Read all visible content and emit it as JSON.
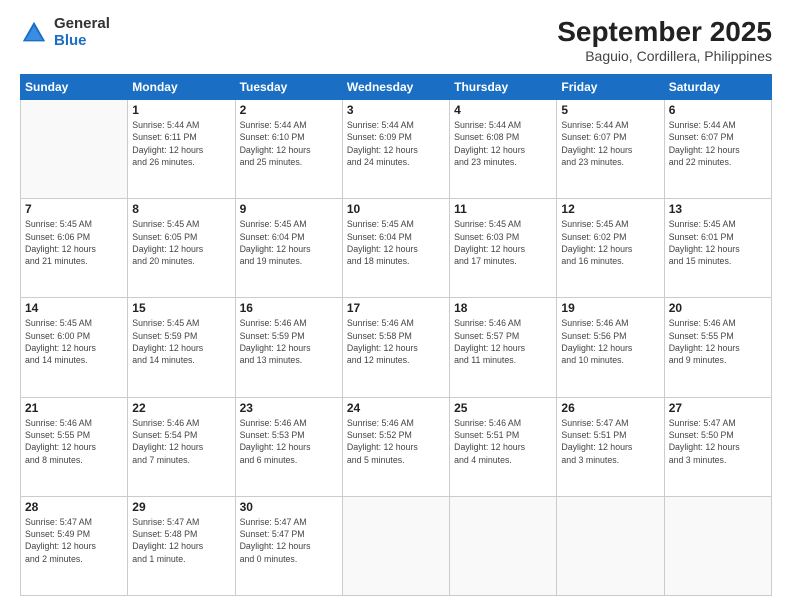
{
  "logo": {
    "general": "General",
    "blue": "Blue"
  },
  "title": "September 2025",
  "subtitle": "Baguio, Cordillera, Philippines",
  "weekdays": [
    "Sunday",
    "Monday",
    "Tuesday",
    "Wednesday",
    "Thursday",
    "Friday",
    "Saturday"
  ],
  "weeks": [
    [
      {
        "day": "",
        "info": ""
      },
      {
        "day": "1",
        "info": "Sunrise: 5:44 AM\nSunset: 6:11 PM\nDaylight: 12 hours\nand 26 minutes."
      },
      {
        "day": "2",
        "info": "Sunrise: 5:44 AM\nSunset: 6:10 PM\nDaylight: 12 hours\nand 25 minutes."
      },
      {
        "day": "3",
        "info": "Sunrise: 5:44 AM\nSunset: 6:09 PM\nDaylight: 12 hours\nand 24 minutes."
      },
      {
        "day": "4",
        "info": "Sunrise: 5:44 AM\nSunset: 6:08 PM\nDaylight: 12 hours\nand 23 minutes."
      },
      {
        "day": "5",
        "info": "Sunrise: 5:44 AM\nSunset: 6:07 PM\nDaylight: 12 hours\nand 23 minutes."
      },
      {
        "day": "6",
        "info": "Sunrise: 5:44 AM\nSunset: 6:07 PM\nDaylight: 12 hours\nand 22 minutes."
      }
    ],
    [
      {
        "day": "7",
        "info": "Sunrise: 5:45 AM\nSunset: 6:06 PM\nDaylight: 12 hours\nand 21 minutes."
      },
      {
        "day": "8",
        "info": "Sunrise: 5:45 AM\nSunset: 6:05 PM\nDaylight: 12 hours\nand 20 minutes."
      },
      {
        "day": "9",
        "info": "Sunrise: 5:45 AM\nSunset: 6:04 PM\nDaylight: 12 hours\nand 19 minutes."
      },
      {
        "day": "10",
        "info": "Sunrise: 5:45 AM\nSunset: 6:04 PM\nDaylight: 12 hours\nand 18 minutes."
      },
      {
        "day": "11",
        "info": "Sunrise: 5:45 AM\nSunset: 6:03 PM\nDaylight: 12 hours\nand 17 minutes."
      },
      {
        "day": "12",
        "info": "Sunrise: 5:45 AM\nSunset: 6:02 PM\nDaylight: 12 hours\nand 16 minutes."
      },
      {
        "day": "13",
        "info": "Sunrise: 5:45 AM\nSunset: 6:01 PM\nDaylight: 12 hours\nand 15 minutes."
      }
    ],
    [
      {
        "day": "14",
        "info": "Sunrise: 5:45 AM\nSunset: 6:00 PM\nDaylight: 12 hours\nand 14 minutes."
      },
      {
        "day": "15",
        "info": "Sunrise: 5:45 AM\nSunset: 5:59 PM\nDaylight: 12 hours\nand 14 minutes."
      },
      {
        "day": "16",
        "info": "Sunrise: 5:46 AM\nSunset: 5:59 PM\nDaylight: 12 hours\nand 13 minutes."
      },
      {
        "day": "17",
        "info": "Sunrise: 5:46 AM\nSunset: 5:58 PM\nDaylight: 12 hours\nand 12 minutes."
      },
      {
        "day": "18",
        "info": "Sunrise: 5:46 AM\nSunset: 5:57 PM\nDaylight: 12 hours\nand 11 minutes."
      },
      {
        "day": "19",
        "info": "Sunrise: 5:46 AM\nSunset: 5:56 PM\nDaylight: 12 hours\nand 10 minutes."
      },
      {
        "day": "20",
        "info": "Sunrise: 5:46 AM\nSunset: 5:55 PM\nDaylight: 12 hours\nand 9 minutes."
      }
    ],
    [
      {
        "day": "21",
        "info": "Sunrise: 5:46 AM\nSunset: 5:55 PM\nDaylight: 12 hours\nand 8 minutes."
      },
      {
        "day": "22",
        "info": "Sunrise: 5:46 AM\nSunset: 5:54 PM\nDaylight: 12 hours\nand 7 minutes."
      },
      {
        "day": "23",
        "info": "Sunrise: 5:46 AM\nSunset: 5:53 PM\nDaylight: 12 hours\nand 6 minutes."
      },
      {
        "day": "24",
        "info": "Sunrise: 5:46 AM\nSunset: 5:52 PM\nDaylight: 12 hours\nand 5 minutes."
      },
      {
        "day": "25",
        "info": "Sunrise: 5:46 AM\nSunset: 5:51 PM\nDaylight: 12 hours\nand 4 minutes."
      },
      {
        "day": "26",
        "info": "Sunrise: 5:47 AM\nSunset: 5:51 PM\nDaylight: 12 hours\nand 3 minutes."
      },
      {
        "day": "27",
        "info": "Sunrise: 5:47 AM\nSunset: 5:50 PM\nDaylight: 12 hours\nand 3 minutes."
      }
    ],
    [
      {
        "day": "28",
        "info": "Sunrise: 5:47 AM\nSunset: 5:49 PM\nDaylight: 12 hours\nand 2 minutes."
      },
      {
        "day": "29",
        "info": "Sunrise: 5:47 AM\nSunset: 5:48 PM\nDaylight: 12 hours\nand 1 minute."
      },
      {
        "day": "30",
        "info": "Sunrise: 5:47 AM\nSunset: 5:47 PM\nDaylight: 12 hours\nand 0 minutes."
      },
      {
        "day": "",
        "info": ""
      },
      {
        "day": "",
        "info": ""
      },
      {
        "day": "",
        "info": ""
      },
      {
        "day": "",
        "info": ""
      }
    ]
  ]
}
